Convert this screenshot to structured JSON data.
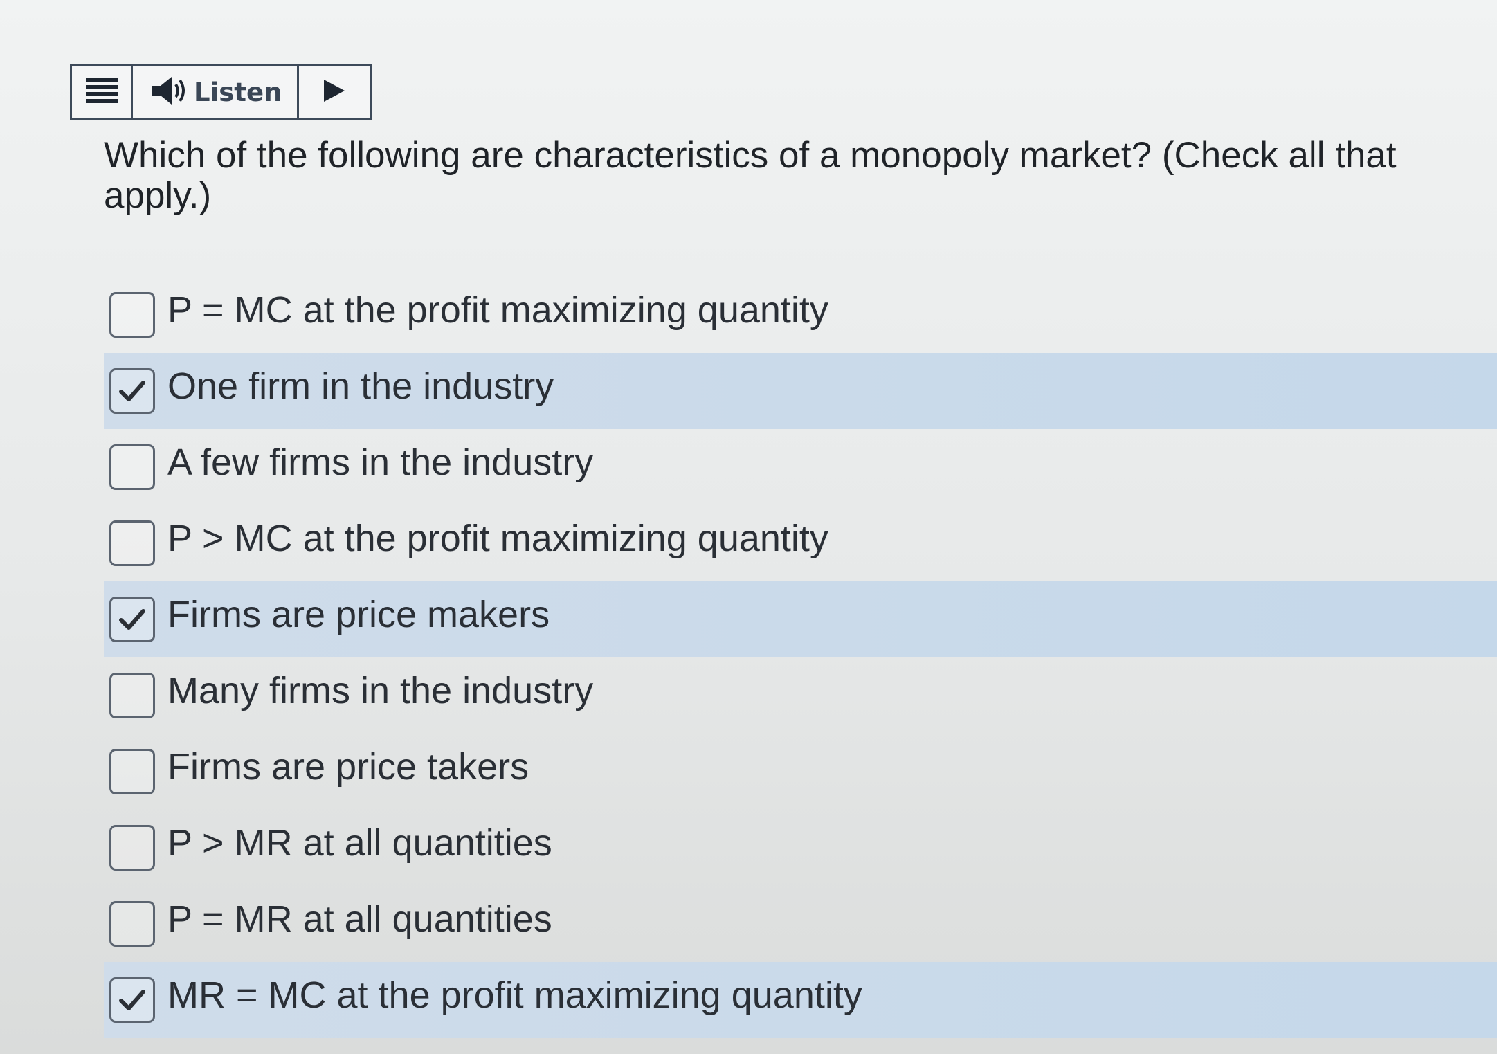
{
  "toolbar": {
    "menu_icon": "hamburger-icon",
    "speaker_icon": "speaker-icon",
    "listen_label": "Listen",
    "play_icon": "play-icon"
  },
  "question": {
    "line1": "Which of the following are characteristics of a monopoly market?  (Check all that",
    "line2": "apply.)"
  },
  "options": [
    {
      "label": "P = MC at the profit maximizing quantity",
      "checked": false
    },
    {
      "label": "One firm in the industry",
      "checked": true
    },
    {
      "label": "A few firms in the industry",
      "checked": false
    },
    {
      "label": "P > MC at the profit maximizing quantity",
      "checked": false
    },
    {
      "label": "Firms are price makers",
      "checked": true
    },
    {
      "label": "Many firms in the industry",
      "checked": false
    },
    {
      "label": "Firms are price takers",
      "checked": false
    },
    {
      "label": "P > MR at all quantities",
      "checked": false
    },
    {
      "label": "P = MR at all quantities",
      "checked": false
    },
    {
      "label": "MR = MC at the profit maximizing quantity",
      "checked": true
    }
  ],
  "colors": {
    "selected_row": "#c5d8ea",
    "toolbar_border": "#3d4a5a",
    "checkmark": "#2b2f35"
  }
}
